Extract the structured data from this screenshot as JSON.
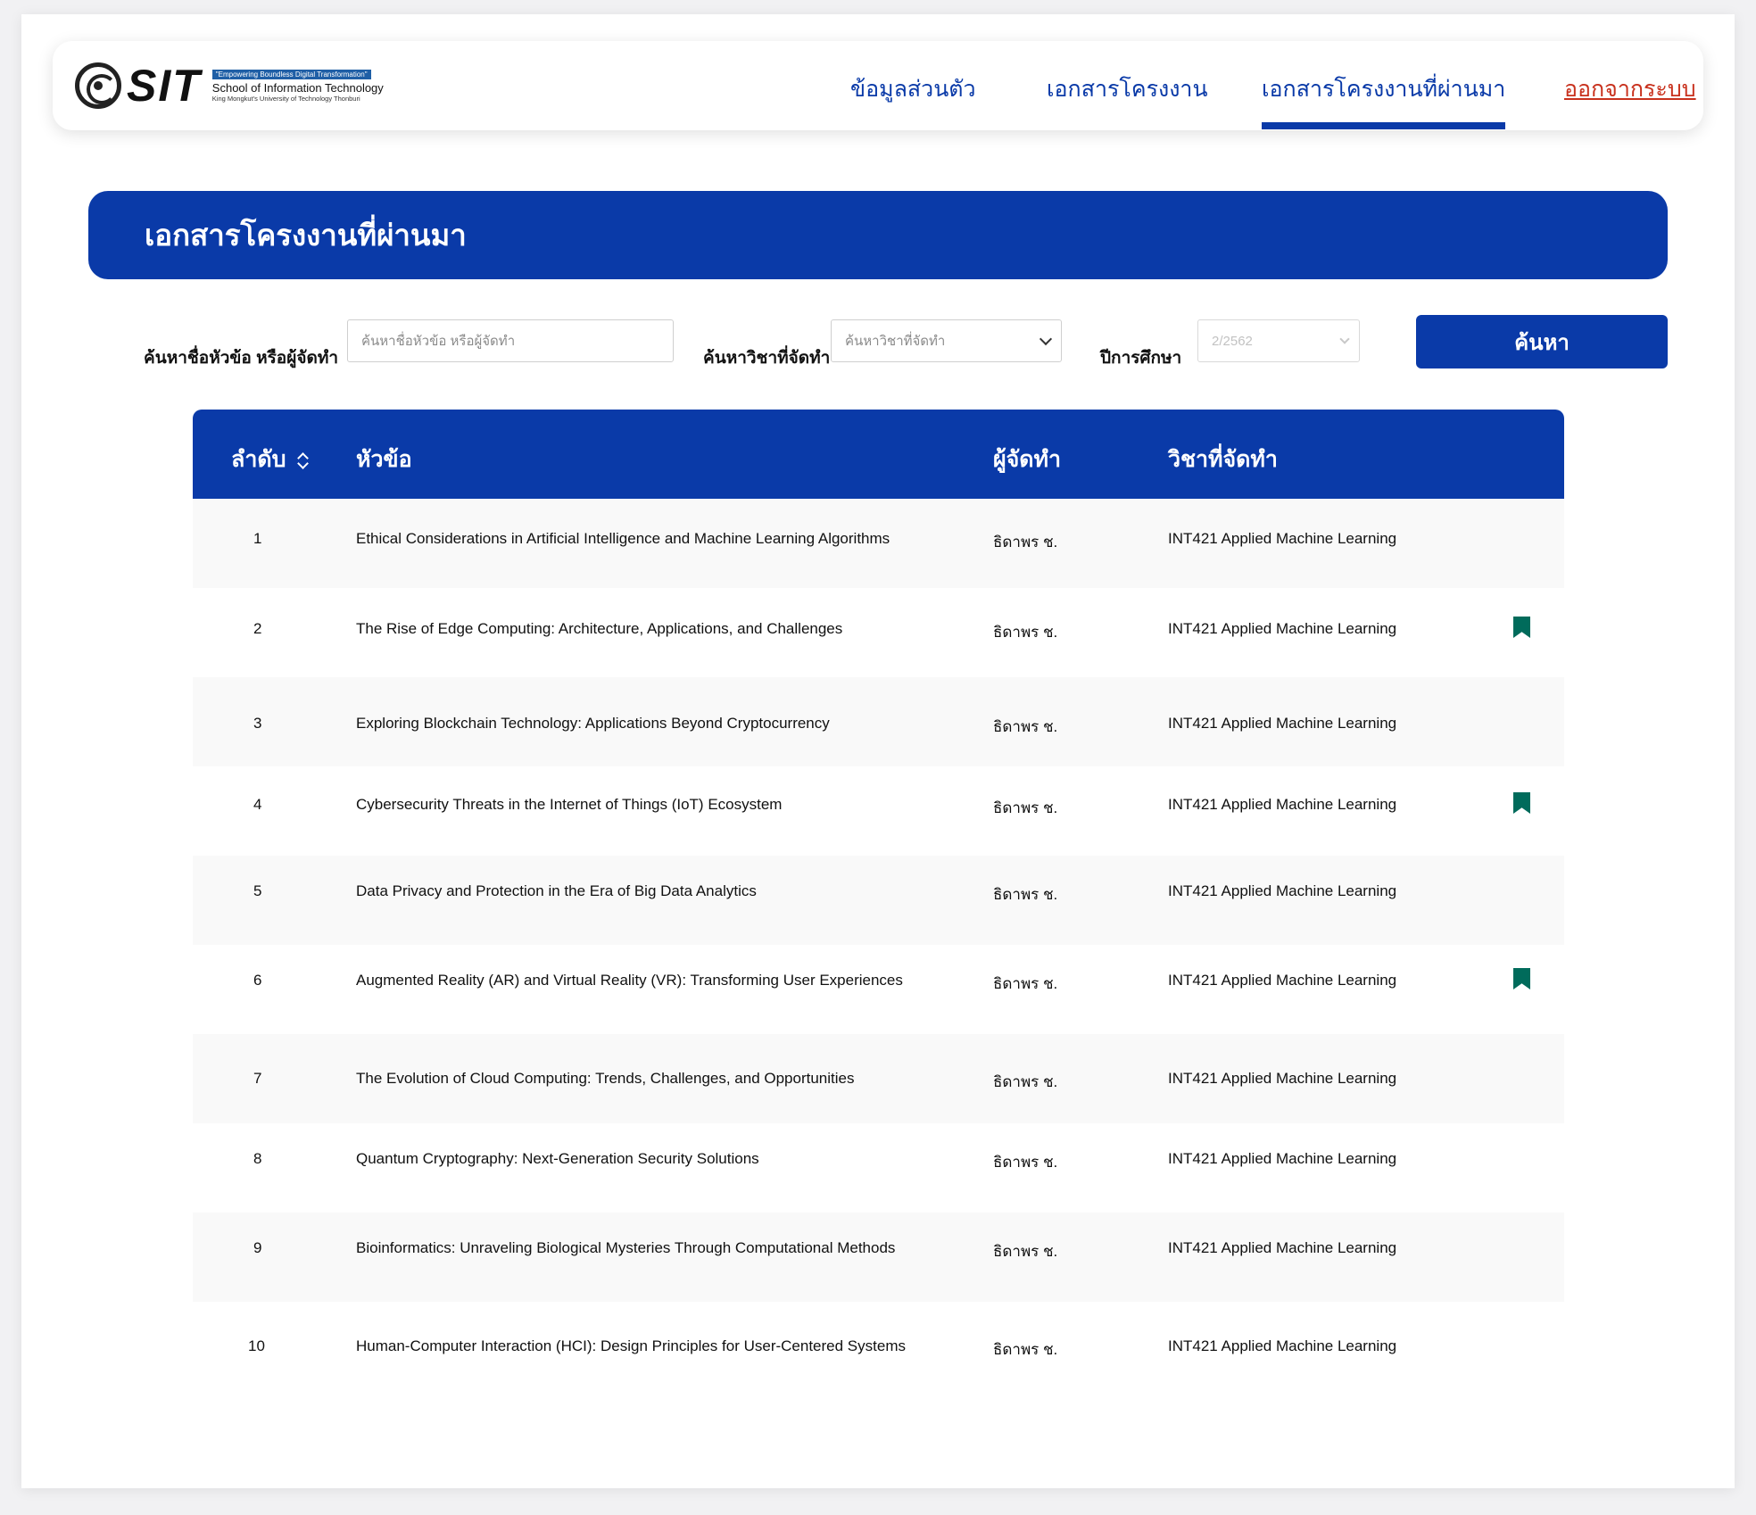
{
  "logo": {
    "word": "SIT",
    "tagline": "\"Empowering Boundless Digital Transformation\"",
    "school": "School of Information Technology",
    "university": "King Mongkut's University of Technology Thonburi"
  },
  "nav": {
    "items": [
      {
        "label": "ข้อมูลส่วนตัว"
      },
      {
        "label": "เอกสารโครงงาน"
      },
      {
        "label": "เอกสารโครงงานที่ผ่านมา",
        "active": true
      }
    ],
    "logout": "ออกจากระบบ"
  },
  "page_title": "เอกสารโครงงานที่ผ่านมา",
  "filters": {
    "topic_label": "ค้นหาชื่อหัวข้อ หรือผู้จัดทำ",
    "topic_placeholder": "ค้นหาชื่อหัวข้อ หรือผู้จัดทำ",
    "subject_label": "ค้นหาวิชาที่จัดทำ",
    "subject_placeholder": "ค้นหาวิชาที่จัดทำ",
    "year_label": "ปีการศึกษา",
    "year_value": "2/2562",
    "search_button": "ค้นหา"
  },
  "table": {
    "headers": [
      "ลำดับ",
      "หัวข้อ",
      "ผู้จัดทำ",
      "วิชาที่จัดทำ"
    ],
    "rows": [
      {
        "num": "1",
        "topic": "Ethical Considerations in Artificial Intelligence and Machine Learning Algorithms",
        "author": "ธิดาพร ช.",
        "subject": "INT421 Applied Machine Learning",
        "bookmarked": false
      },
      {
        "num": "2",
        "topic": "The Rise of Edge Computing: Architecture, Applications, and Challenges",
        "author": "ธิดาพร ช.",
        "subject": "INT421 Applied Machine Learning",
        "bookmarked": true
      },
      {
        "num": "3",
        "topic": "Exploring Blockchain Technology: Applications Beyond Cryptocurrency",
        "author": "ธิดาพร ช.",
        "subject": "INT421 Applied Machine Learning",
        "bookmarked": false
      },
      {
        "num": "4",
        "topic": "Cybersecurity Threats in the Internet of Things (IoT) Ecosystem",
        "author": "ธิดาพร ช.",
        "subject": "INT421 Applied Machine Learning",
        "bookmarked": true
      },
      {
        "num": "5",
        "topic": "Data Privacy and Protection in the Era of Big Data Analytics",
        "author": "ธิดาพร ช.",
        "subject": "INT421 Applied Machine Learning",
        "bookmarked": false
      },
      {
        "num": "6",
        "topic": "Augmented Reality (AR) and Virtual Reality (VR): Transforming User Experiences",
        "author": "ธิดาพร ช.",
        "subject": "INT421 Applied Machine Learning",
        "bookmarked": true
      },
      {
        "num": "7",
        "topic": "The Evolution of Cloud Computing: Trends, Challenges, and Opportunities",
        "author": "ธิดาพร ช.",
        "subject": "INT421 Applied Machine Learning",
        "bookmarked": false
      },
      {
        "num": "8",
        "topic": "Quantum Cryptography: Next-Generation Security Solutions",
        "author": "ธิดาพร ช.",
        "subject": "INT421 Applied Machine Learning",
        "bookmarked": false
      },
      {
        "num": "9",
        "topic": "Bioinformatics: Unraveling Biological Mysteries Through Computational Methods",
        "author": "ธิดาพร ช.",
        "subject": "INT421 Applied Machine Learning",
        "bookmarked": false
      },
      {
        "num": "10",
        "topic": "Human-Computer Interaction (HCI): Design Principles for User-Centered Systems",
        "author": "ธิดาพร ช.",
        "subject": "INT421 Applied Machine Learning",
        "bookmarked": false
      }
    ]
  },
  "colors": {
    "primary": "#0a3aa8",
    "logout": "#c8311d",
    "bookmark": "#006b5b"
  }
}
